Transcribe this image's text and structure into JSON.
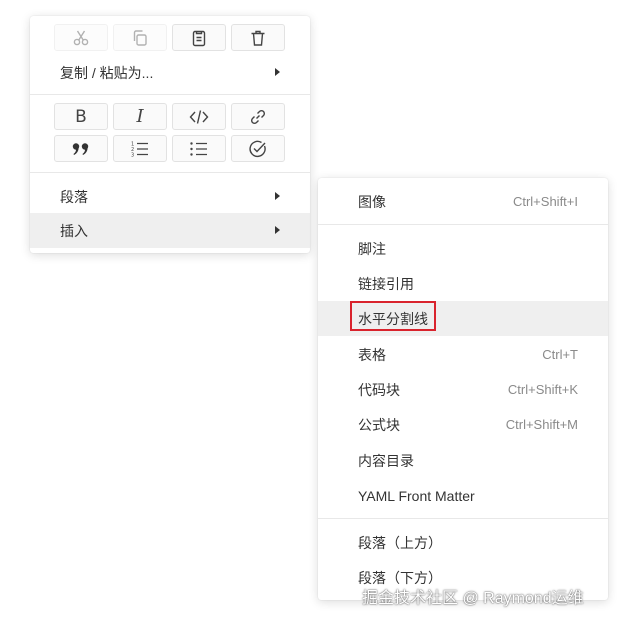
{
  "main_menu": {
    "icon_rows": [
      [
        {
          "name": "cut-icon",
          "disabled": true
        },
        {
          "name": "copy-icon",
          "disabled": true
        },
        {
          "name": "paste-icon",
          "disabled": false
        },
        {
          "name": "delete-icon",
          "disabled": false
        }
      ],
      [
        {
          "name": "bold-icon",
          "text": "B"
        },
        {
          "name": "italic-icon",
          "text": "I"
        },
        {
          "name": "code-icon"
        },
        {
          "name": "link-icon"
        }
      ],
      [
        {
          "name": "quote-icon",
          "text": "99"
        },
        {
          "name": "ordered-list-icon"
        },
        {
          "name": "bullet-list-icon"
        },
        {
          "name": "task-list-icon"
        }
      ]
    ],
    "copy_paste_as": "复制 / 粘贴为...",
    "paragraph": "段落",
    "insert": "插入"
  },
  "sub_menu": {
    "items": [
      {
        "label": "图像",
        "shortcut": "Ctrl+Shift+I"
      },
      {
        "label": "脚注",
        "shortcut": ""
      },
      {
        "label": "链接引用",
        "shortcut": ""
      },
      {
        "label": "水平分割线",
        "shortcut": ""
      },
      {
        "label": "表格",
        "shortcut": "Ctrl+T"
      },
      {
        "label": "代码块",
        "shortcut": "Ctrl+Shift+K"
      },
      {
        "label": "公式块",
        "shortcut": "Ctrl+Shift+M"
      },
      {
        "label": "内容目录",
        "shortcut": ""
      },
      {
        "label": "YAML Front Matter",
        "shortcut": ""
      },
      {
        "label": "段落（上方）",
        "shortcut": ""
      },
      {
        "label": "段落（下方）",
        "shortcut": ""
      }
    ]
  },
  "watermark": "掘金技术社区 @ Raymond运维",
  "colors": {
    "hover_background": "#efefef",
    "highlight_border": "#d9232d",
    "text": "#333333",
    "shortcut_text": "#8a8a8a"
  }
}
